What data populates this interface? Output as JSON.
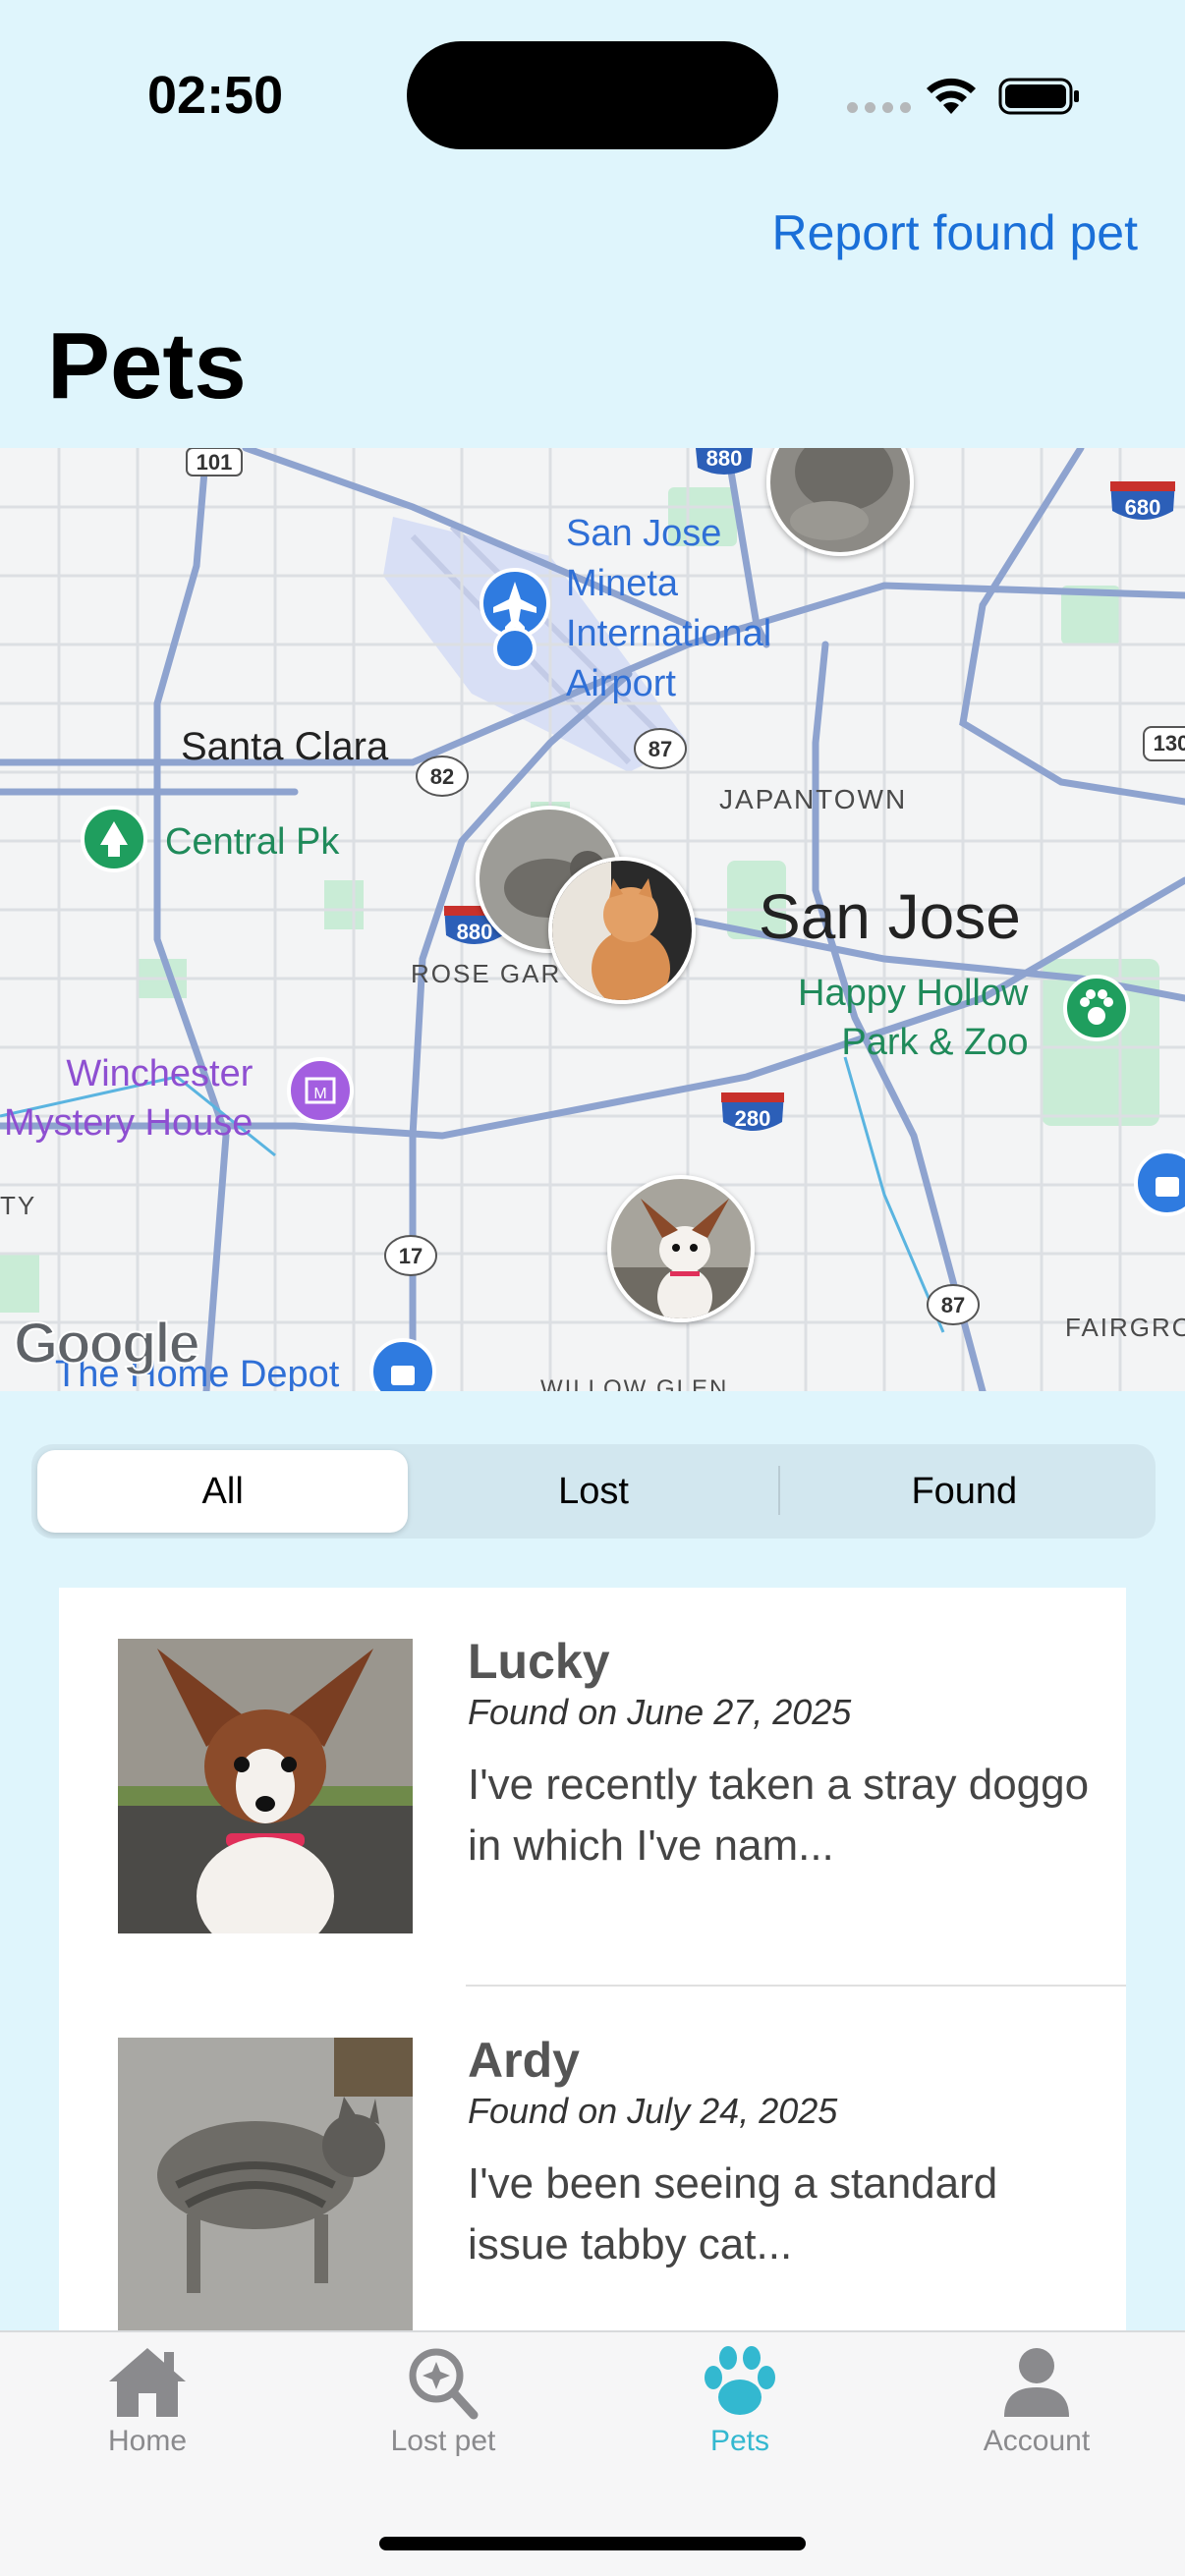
{
  "status_bar": {
    "time": "02:50"
  },
  "header": {
    "report_link": "Report found pet",
    "title": "Pets"
  },
  "map": {
    "labels": {
      "airport": "San Jose Mineta International Airport",
      "airport_lines": [
        "San Jose",
        "Mineta",
        "International",
        "Airport"
      ],
      "santa_clara": "Santa Clara",
      "central_pk": "Central Pk",
      "japantown": "JAPANTOWN",
      "san_jose": "San Jose",
      "happy_hollow_lines": [
        "Happy Hollow",
        "Park & Zoo"
      ],
      "rose_garden": "ROSE GAR",
      "winchester_lines": [
        "Winchester",
        "Mystery House"
      ],
      "home_depot": "The Home Depot",
      "fairgrounds": "FAIRGRO",
      "willow_glen": "WILLOW GLEN",
      "ty": "TY"
    },
    "shields": [
      "101",
      "880",
      "680",
      "82",
      "87",
      "880",
      "280",
      "17",
      "87",
      "130"
    ],
    "attribution": "Google"
  },
  "filter": {
    "options": [
      "All",
      "Lost",
      "Found"
    ],
    "selected": "All"
  },
  "pets": [
    {
      "name": "Lucky",
      "status": "Found on June 27, 2025",
      "description": "I've recently taken a stray doggo in which I've nam..."
    },
    {
      "name": "Ardy",
      "status": "Found on July 24, 2025",
      "description": "I've been seeing a standard issue tabby cat..."
    }
  ],
  "tab_bar": {
    "tabs": [
      {
        "label": "Home",
        "icon": "house-icon"
      },
      {
        "label": "Lost pet",
        "icon": "magnifier-sparkle-icon"
      },
      {
        "label": "Pets",
        "icon": "paw-icon"
      },
      {
        "label": "Account",
        "icon": "person-icon"
      }
    ],
    "active": "Pets"
  },
  "colors": {
    "background": "#dff5fc",
    "accent_link": "#1a6fd8",
    "tab_active": "#33b8d0",
    "tab_inactive": "#8a8a8d"
  }
}
